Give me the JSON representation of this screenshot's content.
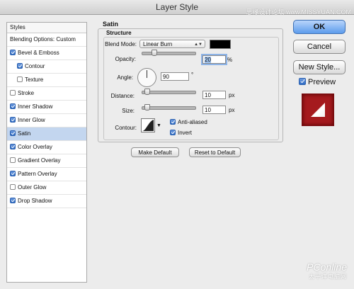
{
  "window": {
    "title": "Layer Style"
  },
  "watermarks": {
    "top": "思缘设计论坛 www.MISSYUAN.COM",
    "bottom_brand": "PConline",
    "bottom_sub": "太平洋电脑网"
  },
  "styles_panel": {
    "header": "Styles",
    "items": [
      {
        "label": "Blending Options: Custom",
        "checkbox": false,
        "checked": false,
        "indent": false,
        "selected": false
      },
      {
        "label": "Bevel & Emboss",
        "checkbox": true,
        "checked": true,
        "indent": false,
        "selected": false
      },
      {
        "label": "Contour",
        "checkbox": true,
        "checked": true,
        "indent": true,
        "selected": false
      },
      {
        "label": "Texture",
        "checkbox": true,
        "checked": false,
        "indent": true,
        "selected": false
      },
      {
        "label": "Stroke",
        "checkbox": true,
        "checked": false,
        "indent": false,
        "selected": false
      },
      {
        "label": "Inner Shadow",
        "checkbox": true,
        "checked": true,
        "indent": false,
        "selected": false
      },
      {
        "label": "Inner Glow",
        "checkbox": true,
        "checked": true,
        "indent": false,
        "selected": false
      },
      {
        "label": "Satin",
        "checkbox": true,
        "checked": true,
        "indent": false,
        "selected": true
      },
      {
        "label": "Color Overlay",
        "checkbox": true,
        "checked": true,
        "indent": false,
        "selected": false
      },
      {
        "label": "Gradient Overlay",
        "checkbox": true,
        "checked": false,
        "indent": false,
        "selected": false
      },
      {
        "label": "Pattern Overlay",
        "checkbox": true,
        "checked": true,
        "indent": false,
        "selected": false
      },
      {
        "label": "Outer Glow",
        "checkbox": true,
        "checked": false,
        "indent": false,
        "selected": false
      },
      {
        "label": "Drop Shadow",
        "checkbox": true,
        "checked": true,
        "indent": false,
        "selected": false
      }
    ]
  },
  "satin": {
    "title": "Satin",
    "structure_title": "Structure",
    "blend_mode": {
      "label": "Blend Mode:",
      "value": "Linear Burn",
      "color": "#000000"
    },
    "opacity": {
      "label": "Opacity:",
      "value": "20",
      "unit": "%",
      "level": 0.2
    },
    "angle": {
      "label": "Angle:",
      "value": "90",
      "unit": "°"
    },
    "distance": {
      "label": "Distance:",
      "value": "10",
      "unit": "px",
      "level": 0.04
    },
    "size": {
      "label": "Size:",
      "value": "10",
      "unit": "px",
      "level": 0.04
    },
    "contour": {
      "label": "Contour:",
      "anti_aliased": "Anti-aliased",
      "anti_aliased_checked": true,
      "invert": "Invert",
      "invert_checked": true
    },
    "make_default": "Make Default",
    "reset_default": "Reset to Default"
  },
  "buttons": {
    "ok": "OK",
    "cancel": "Cancel",
    "new_style": "New Style...",
    "preview": "Preview",
    "preview_checked": true
  }
}
